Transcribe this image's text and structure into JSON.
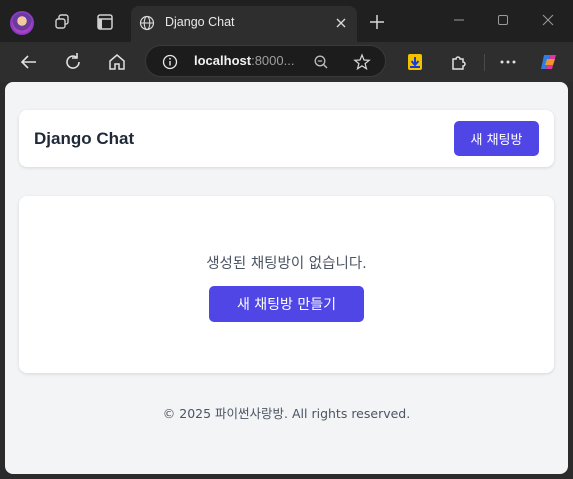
{
  "browser": {
    "tab": {
      "title": "Django Chat",
      "icon": "globe-icon"
    },
    "address_bar": {
      "host": "localhost",
      "port_truncated": ":8000..."
    },
    "colors": {
      "chrome_dark": "#202020",
      "toolbar": "#2e2e2e",
      "omnibox": "#1c1c1c"
    }
  },
  "page": {
    "header": {
      "title": "Django Chat",
      "new_room_button": "새 채팅방"
    },
    "empty_state": {
      "message": "생성된 채팅방이 없습니다.",
      "create_button": "새 채팅방 만들기"
    },
    "footer": {
      "text": "© 2025 파이썬사랑방. All rights reserved."
    },
    "colors": {
      "accent": "#4f46e5",
      "background": "#f3f4f6",
      "card": "#ffffff",
      "title": "#1f2937",
      "muted": "#4b5563"
    }
  }
}
